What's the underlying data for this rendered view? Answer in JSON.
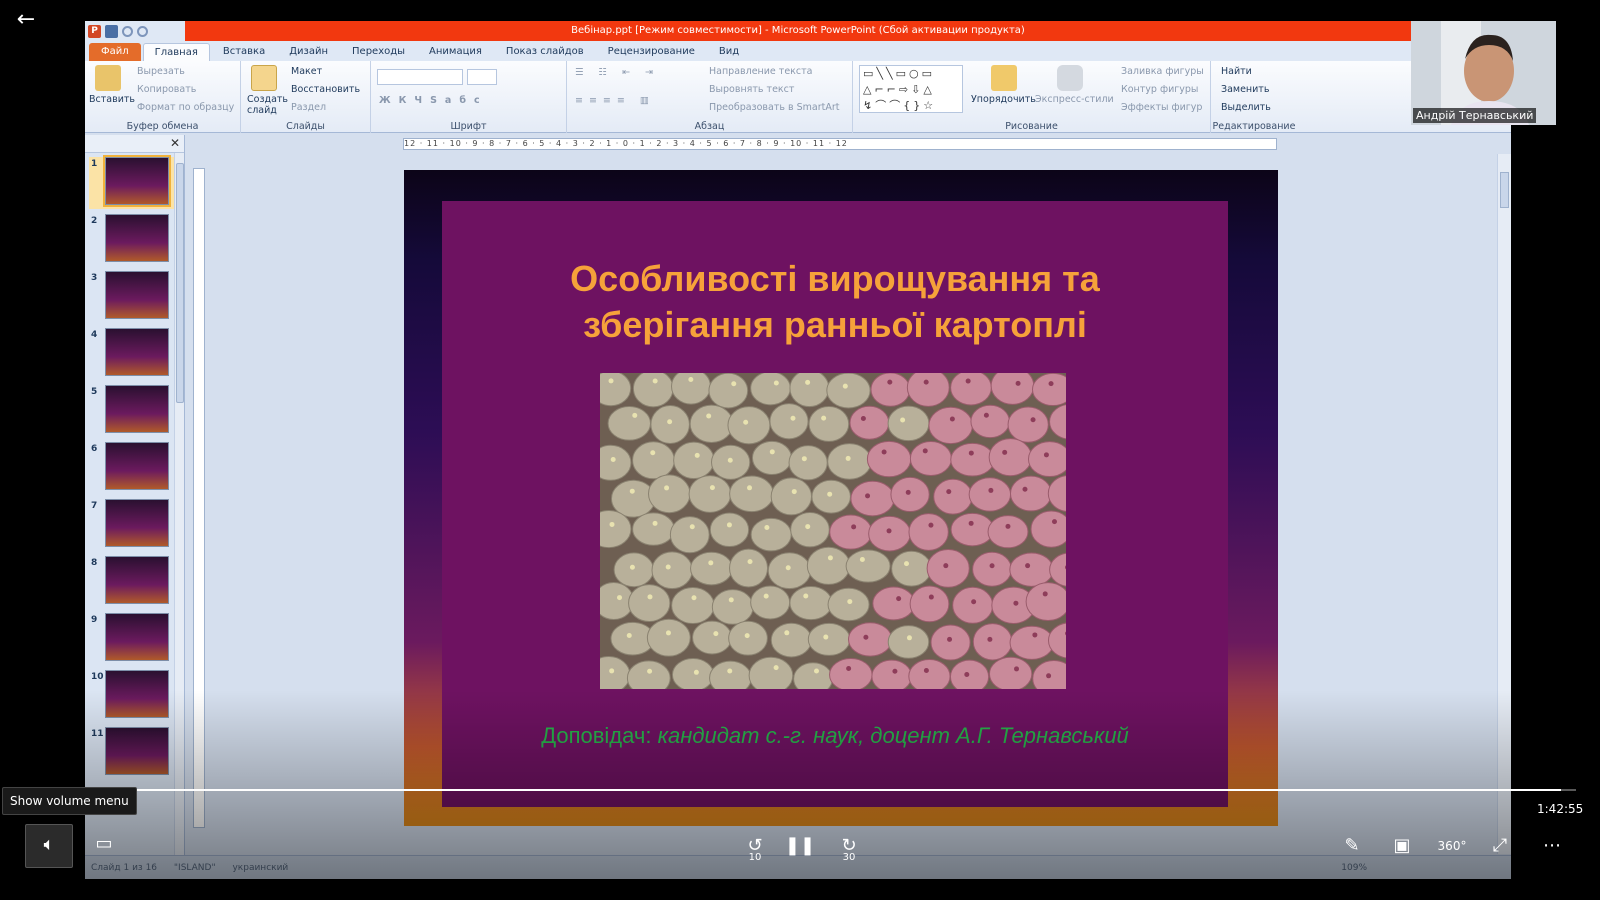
{
  "window": {
    "title": "Вебінар.ppt [Режим совместимости]  -  Microsoft PowerPoint (Сбой активации продукта)"
  },
  "tabs": [
    {
      "label": "Файл"
    },
    {
      "label": "Главная"
    },
    {
      "label": "Вставка"
    },
    {
      "label": "Дизайн"
    },
    {
      "label": "Переходы"
    },
    {
      "label": "Анимация"
    },
    {
      "label": "Показ слайдов"
    },
    {
      "label": "Рецензирование"
    },
    {
      "label": "Вид"
    }
  ],
  "ribbon": {
    "clipboard": {
      "label": "Буфер обмена",
      "paste": "Вставить",
      "cut": "Вырезать",
      "copy": "Копировать",
      "format": "Формат по образцу"
    },
    "slides": {
      "label": "Слайды",
      "new": "Создать слайд",
      "layout": "Макет",
      "reset": "Восстановить",
      "section": "Раздел"
    },
    "font": {
      "label": "Шрифт"
    },
    "paragraph": {
      "label": "Абзац",
      "direction": "Направление текста",
      "align": "Выровнять текст",
      "smartart": "Преобразовать в SmartArt"
    },
    "drawing": {
      "label": "Рисование",
      "arrange": "Упорядочить",
      "styles": "Экспресс-стили",
      "fill": "Заливка фигуры",
      "outline": "Контур фигуры",
      "effects": "Эффекты фигур"
    },
    "editing": {
      "label": "Редактирование",
      "find": "Найти",
      "replace": "Заменить",
      "select": "Выделить"
    }
  },
  "ruler": {
    "text": "12 · 11 · 10 · 9 · 8 · 7 · 6 · 5 · 4 · 3 · 2 · 1 · 0 · 1 · 2 · 3 · 4 · 5 · 6 · 7 · 8 · 9 · 10 · 11 · 12"
  },
  "thumbnails": [
    {
      "num": "1"
    },
    {
      "num": "2"
    },
    {
      "num": "3"
    },
    {
      "num": "4"
    },
    {
      "num": "5"
    },
    {
      "num": "6"
    },
    {
      "num": "7"
    },
    {
      "num": "8"
    },
    {
      "num": "9"
    },
    {
      "num": "10"
    },
    {
      "num": "11"
    }
  ],
  "slide": {
    "title_line1": "Особливості вирощування та",
    "title_line2": "зберігання ранньої картоплі",
    "footer_prefix": "Доповідач:",
    "footer_role": "кандидат с.-г. наук, доцент А.Г. Тернавський"
  },
  "status": {
    "slide": "Слайд 1 из 16",
    "theme": "\"ISLAND\"",
    "lang": "украинский",
    "zoom": "109%"
  },
  "webcam": {
    "name": "Андрій Тернавський"
  },
  "player": {
    "time": "1:42:55",
    "tooltip": "Show volume menu",
    "skip_back": "10",
    "skip_fwd": "30",
    "progress": 0.99
  },
  "colors": {
    "title_orange": "#f6a23a",
    "footer_green": "#26b34a",
    "titlebar_red": "#f2380f"
  }
}
